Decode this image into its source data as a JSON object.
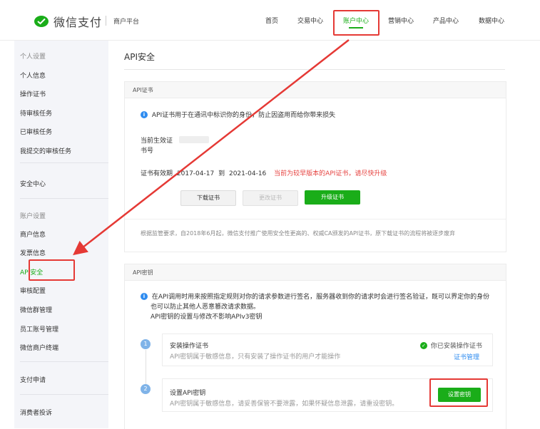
{
  "header": {
    "brand": "微信支付",
    "merchant_platform": "商户平台",
    "nav": [
      "首页",
      "交易中心",
      "账户中心",
      "营销中心",
      "产品中心",
      "数据中心"
    ],
    "active_nav": "账户中心"
  },
  "sidebar": {
    "section_personal": "个人设置",
    "personal_items": [
      "个人信息",
      "操作证书",
      "待审核任务",
      "已审核任务",
      "我提交的审核任务"
    ],
    "security_center": "安全中心",
    "section_account": "账户设置",
    "account_items": [
      "商户信息",
      "发票信息",
      "API安全",
      "审核配置",
      "微信群管理",
      "员工账号管理",
      "微信商户终端"
    ],
    "payment_apply": "支付申请",
    "consumer_complaint": "消费者投诉"
  },
  "main": {
    "title": "API安全",
    "cert_card": {
      "title": "API证书",
      "info": "API证书用于在通讯中标识你的身份，防止因盗用而给你带来损失",
      "current_label_line1": "当前生效证",
      "current_label_line2": "书号",
      "validity_label": "证书有效期",
      "validity_start": "2017-04-17",
      "validity_to": "到",
      "validity_end": "2021-04-16",
      "warning": "当前为较早版本的API证书，请尽快升级",
      "download_button": "下载证书",
      "change_button": "更改证书",
      "upgrade_button": "升级证书",
      "notice": "根据监管要求，自2018年6月起，微信支付推广使用安全性更高的、权威CA颁发的API证书，原下载证书的流程将被逐步废弃"
    },
    "key_card": {
      "title": "API密钥",
      "info_line1": "在API调用时用来按照指定规则对你的请求参数进行签名，服务器收到你的请求时会进行签名验证，既可以界定你的身份",
      "info_line2": "也可以防止其他人恶意篡改请求数据。",
      "info_line3": "API密钥的设置与修改不影响APIv3密钥",
      "step1_num": "1",
      "step1_title": "安装操作证书",
      "step1_desc": "API密钥属于敏感信息，只有安装了操作证书的用户才能操作",
      "step1_status": "你已安装操作证书",
      "step1_link": "证书管理",
      "step2_num": "2",
      "step2_title": "设置API密钥",
      "step2_desc": "API密钥属于敏感信息，请妥善保管不要泄露，如果怀疑信息泄露，请重设密钥。",
      "step2_button": "设置密钥"
    }
  },
  "colors": {
    "brand_green": "#1aad19",
    "highlight_red": "#e53935",
    "warning_red": "#e64340",
    "info_blue": "#2f8cf0"
  }
}
